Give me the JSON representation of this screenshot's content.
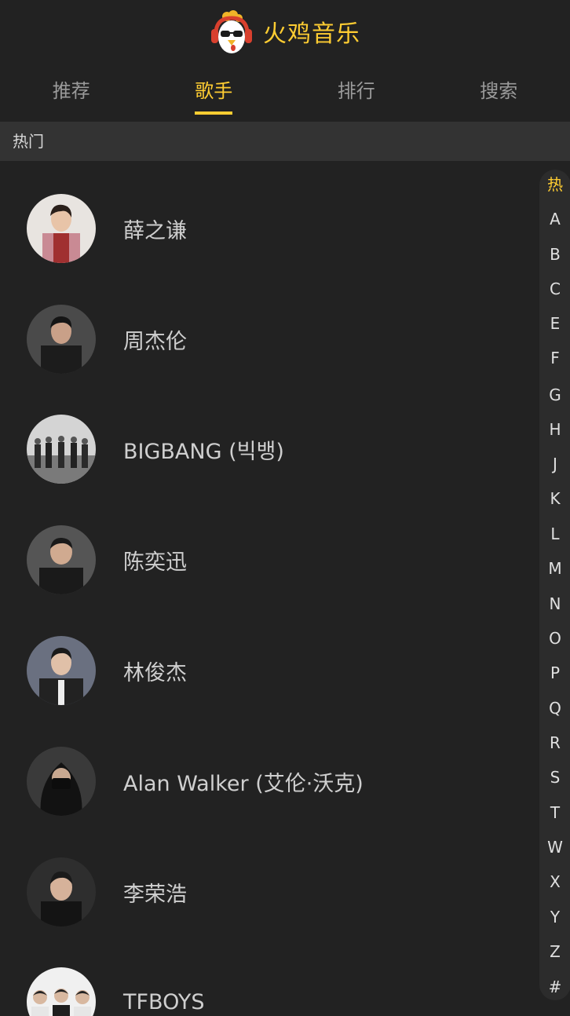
{
  "header": {
    "title": "火鸡音乐",
    "logo_icon": "turkey-logo-icon",
    "title_color": "#ffcd32"
  },
  "tabs": [
    {
      "label": "推荐",
      "active": false
    },
    {
      "label": "歌手",
      "active": true
    },
    {
      "label": "排行",
      "active": false
    },
    {
      "label": "搜索",
      "active": false
    }
  ],
  "group": {
    "title": "热门"
  },
  "singers": [
    {
      "name": "薛之谦",
      "avatar": "singer-photo"
    },
    {
      "name": "周杰伦",
      "avatar": "singer-photo"
    },
    {
      "name": "BIGBANG (빅뱅)",
      "avatar": "group-photo"
    },
    {
      "name": "陈奕迅",
      "avatar": "singer-photo"
    },
    {
      "name": "林俊杰",
      "avatar": "singer-photo"
    },
    {
      "name": "Alan Walker (艾伦·沃克)",
      "avatar": "singer-photo"
    },
    {
      "name": "李荣浩",
      "avatar": "singer-photo"
    },
    {
      "name": "TFBOYS",
      "avatar": "group-photo"
    }
  ],
  "shortcut": {
    "items": [
      "热",
      "A",
      "B",
      "C",
      "E",
      "F",
      "G",
      "H",
      "J",
      "K",
      "L",
      "M",
      "N",
      "O",
      "P",
      "Q",
      "R",
      "S",
      "T",
      "W",
      "X",
      "Y",
      "Z",
      "#"
    ],
    "current": "热",
    "current_color": "#ffcd32"
  },
  "colors": {
    "background": "#222222",
    "group_background": "#333333",
    "accent": "#ffcd32"
  }
}
